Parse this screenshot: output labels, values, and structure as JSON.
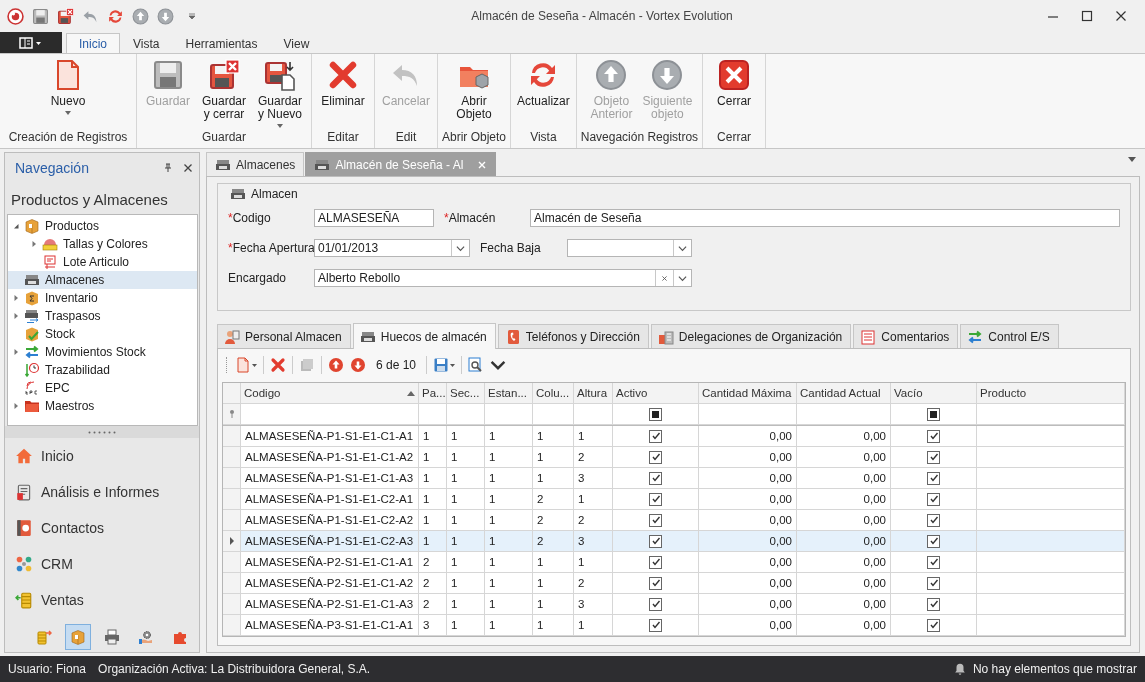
{
  "window": {
    "title": "Almacén de Seseña - Almacén - Vortex Evolution"
  },
  "ribbon": {
    "tabs": [
      {
        "label": "Inicio",
        "selected": true
      },
      {
        "label": "Vista",
        "selected": false
      },
      {
        "label": "Herramientas",
        "selected": false
      },
      {
        "label": "View",
        "selected": false
      }
    ],
    "groups": [
      {
        "label": "Creación de Registros",
        "buttons": [
          {
            "label": "Nuevo",
            "disabled": false,
            "dropdown": true
          }
        ]
      },
      {
        "label": "Guardar",
        "buttons": [
          {
            "label": "Guardar",
            "disabled": true,
            "dropdown": false
          },
          {
            "label": "Guardar\ny cerrar",
            "disabled": false,
            "dropdown": false
          },
          {
            "label": "Guardar\ny Nuevo",
            "disabled": false,
            "dropdown": true
          }
        ]
      },
      {
        "label": "Editar",
        "buttons": [
          {
            "label": "Eliminar",
            "disabled": false,
            "dropdown": false
          }
        ]
      },
      {
        "label": "Edit",
        "buttons": [
          {
            "label": "Cancelar",
            "disabled": true,
            "dropdown": false
          }
        ]
      },
      {
        "label": "Abrir Objeto",
        "buttons": [
          {
            "label": "Abrir\nObjeto",
            "disabled": false,
            "dropdown": false
          }
        ]
      },
      {
        "label": "Vista",
        "buttons": [
          {
            "label": "Actualizar",
            "disabled": false,
            "dropdown": false
          }
        ]
      },
      {
        "label": "Navegación Registros",
        "buttons": [
          {
            "label": "Objeto\nAnterior",
            "disabled": true,
            "dropdown": false
          },
          {
            "label": "Siguiente\nobjeto",
            "disabled": true,
            "dropdown": false
          }
        ]
      },
      {
        "label": "Cerrar",
        "buttons": [
          {
            "label": "Cerrar",
            "disabled": false,
            "dropdown": false
          }
        ]
      }
    ]
  },
  "navigation": {
    "title": "Navegación",
    "section": "Productos y Almacenes",
    "tree": [
      {
        "label": "Productos",
        "expanded": true,
        "selected": false,
        "children": [
          {
            "label": "Tallas y Colores",
            "expanded": false,
            "selected": false
          },
          {
            "label": "Lote Articulo",
            "selected": false
          }
        ]
      },
      {
        "label": "Almacenes",
        "selected": true
      },
      {
        "label": "Inventario",
        "expanded": false,
        "selected": false
      },
      {
        "label": "Traspasos",
        "expanded": false,
        "selected": false
      },
      {
        "label": "Stock",
        "selected": false
      },
      {
        "label": "Movimientos Stock",
        "expanded": false,
        "selected": false
      },
      {
        "label": "Trazabilidad",
        "selected": false
      },
      {
        "label": "EPC",
        "selected": false
      },
      {
        "label": "Maestros",
        "expanded": false,
        "selected": false
      }
    ],
    "modules": [
      {
        "label": "Inicio"
      },
      {
        "label": "Análisis e Informes"
      },
      {
        "label": "Contactos"
      },
      {
        "label": "CRM"
      },
      {
        "label": "Ventas"
      }
    ],
    "shortcuts": [
      {
        "selected": false
      },
      {
        "selected": true
      },
      {
        "selected": false
      },
      {
        "selected": false
      },
      {
        "selected": false
      }
    ]
  },
  "document_tabs": [
    {
      "label": "Almacenes",
      "selected": false
    },
    {
      "label": "Almacén de Seseña - Al",
      "selected": true
    }
  ],
  "form": {
    "group_title": "Almacen",
    "fields": [
      {
        "kind": "text",
        "mark": "*",
        "label": "Codigo",
        "value": "ALMASESEÑA"
      },
      {
        "kind": "text",
        "mark": "*",
        "label": "Almacén",
        "value": "Almacén de Seseña"
      },
      {
        "kind": "date",
        "mark": "*",
        "label": "Fecha Apertura",
        "value": "01/01/2013"
      },
      {
        "kind": "date",
        "label": "Fecha Baja"
      },
      {
        "kind": "lookup",
        "label": "Encargado",
        "value": "Alberto Rebollo"
      }
    ]
  },
  "detail_tabs": [
    {
      "label": "Personal Almacen",
      "selected": false
    },
    {
      "label": "Huecos de almacén",
      "selected": true
    },
    {
      "label": "Teléfonos y Dirección",
      "selected": false
    },
    {
      "label": "Delegaciones de Organización",
      "selected": false
    },
    {
      "label": "Comentarios",
      "selected": false
    },
    {
      "label": "Control E/S",
      "selected": false
    }
  ],
  "grid_toolbar": {
    "position": "6 de 10"
  },
  "grid": {
    "columns": [
      {
        "label": "Codigo",
        "kind": "text",
        "sorted": true
      },
      {
        "label": "Pa...",
        "kind": "text"
      },
      {
        "label": "Sec...",
        "kind": "text"
      },
      {
        "label": "Estan...",
        "kind": "text"
      },
      {
        "label": "Colu...",
        "kind": "text"
      },
      {
        "label": "Altura",
        "kind": "text"
      },
      {
        "label": "Activo",
        "kind": "check",
        "filter_indeterminate": true
      },
      {
        "label": "Cantidad Máxima",
        "kind": "number"
      },
      {
        "label": "Cantidad Actual",
        "kind": "number"
      },
      {
        "label": "Vacío",
        "kind": "check",
        "filter_indeterminate": true
      },
      {
        "label": "Producto",
        "kind": "text"
      }
    ],
    "rows": [
      {
        "selected": false,
        "cells": [
          "ALMASESEÑA-P1-S1-E1-C1-A1",
          "1",
          "1",
          "1",
          "1",
          "1",
          true,
          "0,00",
          "0,00",
          true
        ]
      },
      {
        "selected": false,
        "cells": [
          "ALMASESEÑA-P1-S1-E1-C1-A2",
          "1",
          "1",
          "1",
          "1",
          "2",
          true,
          "0,00",
          "0,00",
          true
        ]
      },
      {
        "selected": false,
        "cells": [
          "ALMASESEÑA-P1-S1-E1-C1-A3",
          "1",
          "1",
          "1",
          "1",
          "3",
          true,
          "0,00",
          "0,00",
          true
        ]
      },
      {
        "selected": false,
        "cells": [
          "ALMASESEÑA-P1-S1-E1-C2-A1",
          "1",
          "1",
          "1",
          "2",
          "1",
          true,
          "0,00",
          "0,00",
          true
        ]
      },
      {
        "selected": false,
        "cells": [
          "ALMASESEÑA-P1-S1-E1-C2-A2",
          "1",
          "1",
          "1",
          "2",
          "2",
          true,
          "0,00",
          "0,00",
          true
        ]
      },
      {
        "selected": true,
        "cells": [
          "ALMASESEÑA-P1-S1-E1-C2-A3",
          "1",
          "1",
          "1",
          "2",
          "3",
          true,
          "0,00",
          "0,00",
          true
        ]
      },
      {
        "selected": false,
        "cells": [
          "ALMASESEÑA-P2-S1-E1-C1-A1",
          "2",
          "1",
          "1",
          "1",
          "1",
          true,
          "0,00",
          "0,00",
          true
        ]
      },
      {
        "selected": false,
        "cells": [
          "ALMASESEÑA-P2-S1-E1-C1-A2",
          "2",
          "1",
          "1",
          "1",
          "2",
          true,
          "0,00",
          "0,00",
          true
        ]
      },
      {
        "selected": false,
        "cells": [
          "ALMASESEÑA-P2-S1-E1-C1-A3",
          "2",
          "1",
          "1",
          "1",
          "3",
          true,
          "0,00",
          "0,00",
          true
        ]
      },
      {
        "selected": false,
        "cells": [
          "ALMASESEÑA-P3-S1-E1-C1-A1",
          "3",
          "1",
          "1",
          "1",
          "1",
          true,
          "0,00",
          "0,00",
          true
        ]
      }
    ]
  },
  "status_bar": {
    "user": "Usuario: Fiona",
    "organization": "Organización Activa: La Distribuidora General, S.A.",
    "notifications": "No hay elementos que mostrar"
  }
}
